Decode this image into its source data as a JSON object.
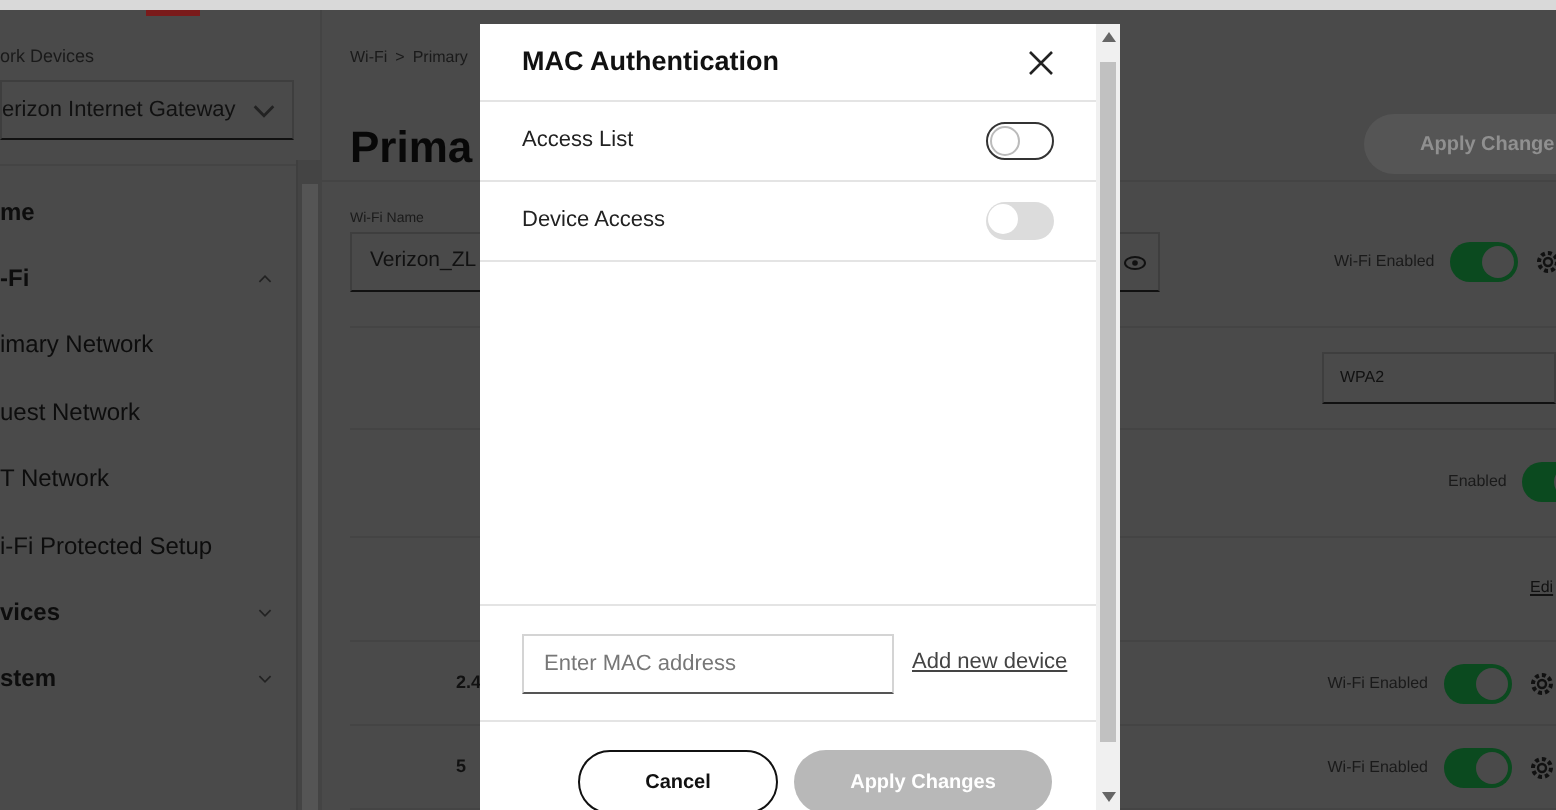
{
  "sidebar": {
    "device_label": "ork Devices",
    "device_select": "erizon Internet Gateway",
    "items": [
      {
        "label": "me",
        "kind": "section"
      },
      {
        "label": "-Fi",
        "kind": "group",
        "expanded": true,
        "children": [
          {
            "label": "imary Network"
          },
          {
            "label": "uest Network"
          },
          {
            "label": "T Network"
          },
          {
            "label": "i-Fi Protected Setup"
          }
        ]
      },
      {
        "label": "vices",
        "kind": "group",
        "expanded": false
      },
      {
        "label": "stem",
        "kind": "group",
        "expanded": false
      }
    ]
  },
  "main": {
    "breadcrumb": [
      "Wi-Fi",
      "Primary"
    ],
    "breadcrumb_separator": ">",
    "title": "Prima",
    "apply_button": {
      "label": "Apply Change",
      "disabled": true
    },
    "wifi_name": {
      "label": "Wi-Fi Name",
      "value": "Verizon_ZL"
    },
    "rows": [
      {
        "kind": "toggle",
        "label": "Wi-Fi Enabled",
        "on": true,
        "gear": true
      },
      {
        "kind": "select",
        "value": "WPA2"
      },
      {
        "kind": "toggle",
        "label": "Enabled",
        "on": true,
        "gear": false
      },
      {
        "kind": "link",
        "label": "Edi"
      },
      {
        "kind": "band",
        "band": "2.4",
        "label": "Wi-Fi Enabled",
        "on": true,
        "gear": true
      },
      {
        "kind": "band",
        "band": "5",
        "label": "Wi-Fi Enabled",
        "on": true,
        "gear": true
      }
    ]
  },
  "modal": {
    "title": "MAC Authentication",
    "settings": [
      {
        "label": "Access List",
        "on": false,
        "disabled": false
      },
      {
        "label": "Device Access",
        "on": false,
        "disabled": true
      }
    ],
    "mac_field": {
      "placeholder": "Enter MAC address"
    },
    "add_link": "Add new device",
    "buttons": [
      {
        "label": "Cancel",
        "kind": "secondary",
        "disabled": false
      },
      {
        "label": "Apply Changes",
        "kind": "primary",
        "disabled": true
      }
    ]
  }
}
